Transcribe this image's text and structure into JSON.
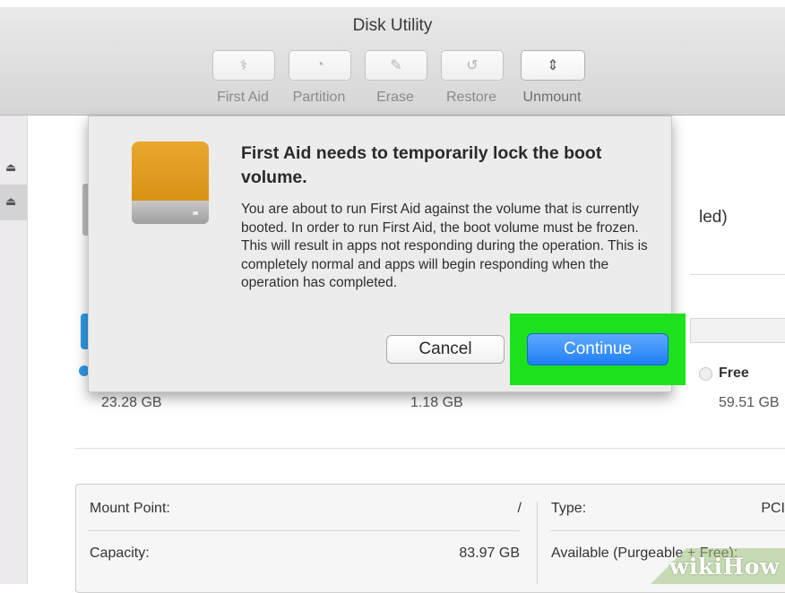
{
  "window": {
    "title": "Disk Utility"
  },
  "toolbar": {
    "buttons": [
      {
        "label": "First Aid",
        "icon": "stethoscope-icon",
        "glyph": "⚕",
        "active": false
      },
      {
        "label": "Partition",
        "icon": "pie-chart-icon",
        "glyph": "◔",
        "active": false
      },
      {
        "label": "Erase",
        "icon": "erase-icon",
        "glyph": "✎",
        "active": false
      },
      {
        "label": "Restore",
        "icon": "restore-icon",
        "glyph": "↺",
        "active": false
      },
      {
        "label": "Unmount",
        "icon": "unmount-icon",
        "glyph": "⇕",
        "active": true
      }
    ]
  },
  "sidebar": {
    "eject_glyph": "⏏"
  },
  "dialog": {
    "title": "First Aid needs to temporarily lock the boot volume.",
    "body": "You are about to run First Aid against the volume that is currently booted. In order to run First Aid, the boot volume must be frozen. This will result in apps not responding during the operation. This is completely normal and apps will begin responding when the operation has completed.",
    "cancel_label": "Cancel",
    "continue_label": "Continue"
  },
  "background": {
    "partial_header_text": "led)",
    "free_label": "Free",
    "stats": {
      "used": "23.28 GB",
      "other": "1.18 GB",
      "free": "59.51 GB"
    },
    "info": {
      "mount_point_label": "Mount Point:",
      "mount_point_value": "/",
      "capacity_label": "Capacity:",
      "capacity_value": "83.97 GB",
      "type_label": "Type:",
      "type_value": "PCI",
      "available_label": "Available (Purgeable + Free):"
    }
  },
  "watermark": {
    "text": "wikiHow"
  },
  "colors": {
    "highlight": "#1ee11e",
    "continue_button": "#1f7ff4",
    "drive": "#e9a72c"
  }
}
